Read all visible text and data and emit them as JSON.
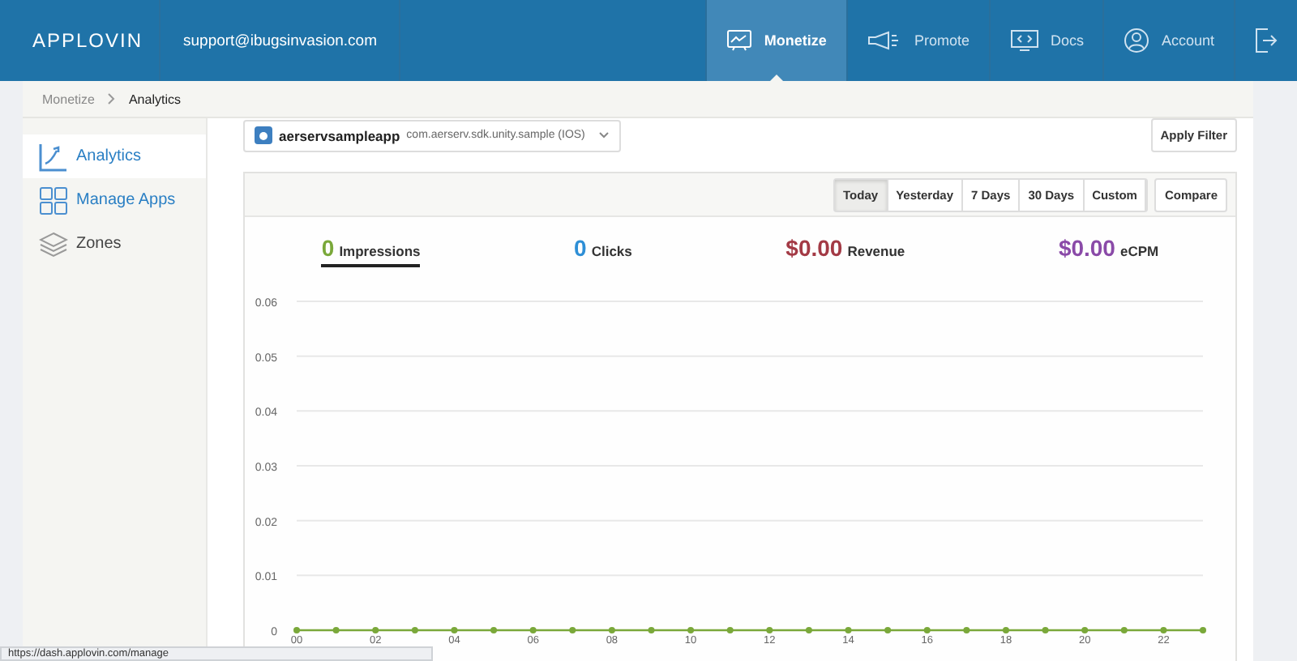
{
  "header": {
    "logo": "APPLOVIN",
    "email": "support@ibugsinvasion.com",
    "nav": [
      {
        "label": "Monetize",
        "selected": true
      },
      {
        "label": "Promote",
        "selected": false
      },
      {
        "label": "Docs",
        "selected": false
      },
      {
        "label": "Account",
        "selected": false
      },
      {
        "selected": false
      }
    ]
  },
  "breadcrumb": [
    {
      "label": "Monetize",
      "current": false
    },
    {
      "label": "Analytics",
      "current": true
    }
  ],
  "sidebar": {
    "items": [
      {
        "label": "Analytics",
        "selected": true
      },
      {
        "label": "Manage Apps",
        "selected": false
      },
      {
        "label": "Zones",
        "selected": false
      }
    ]
  },
  "app_selector": {
    "name": "aerservsampleapp",
    "bundle": "com.aerserv.sdk.unity.sample (IOS)"
  },
  "apply_filter": "Apply Filter",
  "ranges": [
    {
      "label": "Today",
      "selected": true
    },
    {
      "label": "Yesterday",
      "selected": false
    },
    {
      "label": "7 Days",
      "selected": false
    },
    {
      "label": "30 Days",
      "selected": false
    },
    {
      "label": "Custom",
      "selected": false
    }
  ],
  "compare": "Compare",
  "metrics": [
    {
      "value": "0",
      "label": "Impressions",
      "color": "#7aa83a",
      "selected": true
    },
    {
      "value": "0",
      "label": "Clicks",
      "color": "#2e8fd6",
      "selected": false
    },
    {
      "value": "$0.00",
      "label": "Revenue",
      "color": "#a33a45",
      "selected": false
    },
    {
      "value": "$0.00",
      "label": "eCPM",
      "color": "#8a4aa8",
      "selected": false
    }
  ],
  "chart_data": {
    "type": "line",
    "x": [
      0,
      1,
      2,
      3,
      4,
      5,
      6,
      7,
      8,
      9,
      10,
      11,
      12,
      13,
      14,
      15,
      16,
      17,
      18,
      19,
      20,
      21,
      22,
      23
    ],
    "grid": true,
    "series": [
      {
        "color": "#7aa83a",
        "marker": true,
        "values": [
          0,
          0,
          0,
          0,
          0,
          0,
          0,
          0,
          0,
          0,
          0,
          0,
          0,
          0,
          0,
          0,
          0,
          0,
          0,
          0,
          0,
          0,
          0,
          0
        ]
      }
    ],
    "xlim": [
      0,
      23
    ],
    "ylim": [
      0,
      0.06
    ],
    "xticks": [
      {
        "value": 0,
        "label": "00"
      },
      {
        "value": 2,
        "label": "02"
      },
      {
        "value": 4,
        "label": "04"
      },
      {
        "value": 6,
        "label": "06"
      },
      {
        "value": 8,
        "label": "08"
      },
      {
        "value": 10,
        "label": "10"
      },
      {
        "value": 12,
        "label": "12"
      },
      {
        "value": 14,
        "label": "14"
      },
      {
        "value": 16,
        "label": "16"
      },
      {
        "value": 18,
        "label": "18"
      },
      {
        "value": 20,
        "label": "20"
      },
      {
        "value": 22,
        "label": "22"
      }
    ],
    "yticks": [
      0,
      0.01,
      0.02,
      0.03,
      0.04,
      0.05,
      0.06
    ]
  },
  "status_url": "https://dash.applovin.com/manage"
}
